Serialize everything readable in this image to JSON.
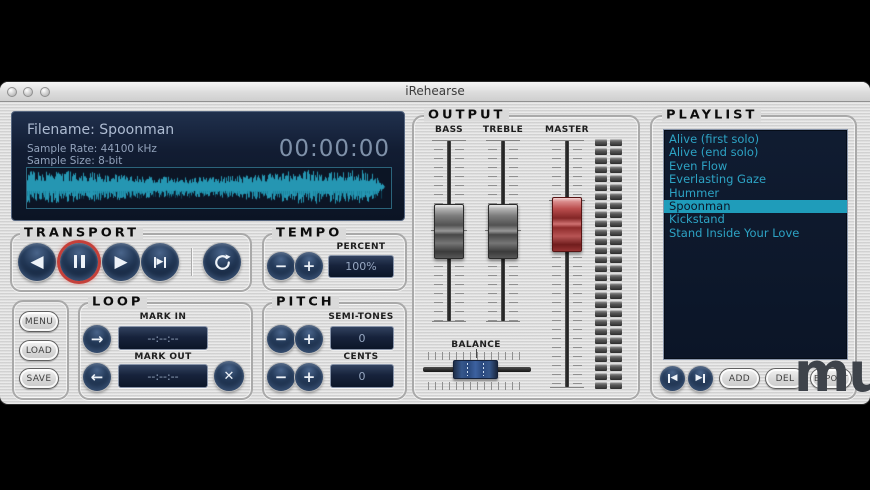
{
  "window": {
    "title": "iRehearse"
  },
  "display": {
    "filename": "Filename: Spoonman",
    "sample_rate": "Sample Rate: 44100 kHz",
    "sample_size": "Sample Size: 8-bit",
    "timer": "00:00:00"
  },
  "transport": {
    "header": "TRANSPORT"
  },
  "tempo": {
    "header": "TEMPO",
    "percent_label": "PERCENT",
    "percent_value": "100%"
  },
  "loop": {
    "header": "LOOP",
    "mark_in_label": "MARK IN",
    "mark_in_value": "--:--:--",
    "mark_out_label": "MARK OUT",
    "mark_out_value": "--:--:--"
  },
  "pitch": {
    "header": "PITCH",
    "semitones_label": "SEMI-TONES",
    "semitones_value": "0",
    "cents_label": "CENTS",
    "cents_value": "0"
  },
  "file_buttons": {
    "menu": "MENU",
    "load": "LOAD",
    "save": "SAVE"
  },
  "output": {
    "header": "OUTPUT",
    "bass_label": "BASS",
    "treble_label": "TREBLE",
    "master_label": "MASTER",
    "balance_label": "BALANCE"
  },
  "playlist": {
    "header": "PLAYLIST",
    "items": [
      "Alive (first solo)",
      "Alive (end solo)",
      "Even Flow",
      "Everlasting Gaze",
      "Hummer",
      "Spoonman",
      "Kickstand",
      "Stand Inside Your Love"
    ],
    "selected_index": 5,
    "selected_item": "Spoonman",
    "add": "ADD",
    "del": "DEL",
    "export": "EXPORT"
  },
  "icons": {
    "minus": "−",
    "plus": "+",
    "arrow_right": "→",
    "arrow_left": "←",
    "close": "✕",
    "tri_left": "◀",
    "tri_right": "▶"
  },
  "watermark": {
    "text": "mu",
    "arrow": "▲"
  },
  "colors": {
    "accent_teal": "#2da3c4",
    "selected_row_bg": "#1f9cba",
    "master_handle_red": "#b94a4a",
    "balance_handle_blue": "#3d62a0",
    "display_navy": "#0d1728",
    "pause_ring_red": "#c5403a"
  },
  "meter": {
    "columns": 2,
    "segments_per_column": 28
  }
}
